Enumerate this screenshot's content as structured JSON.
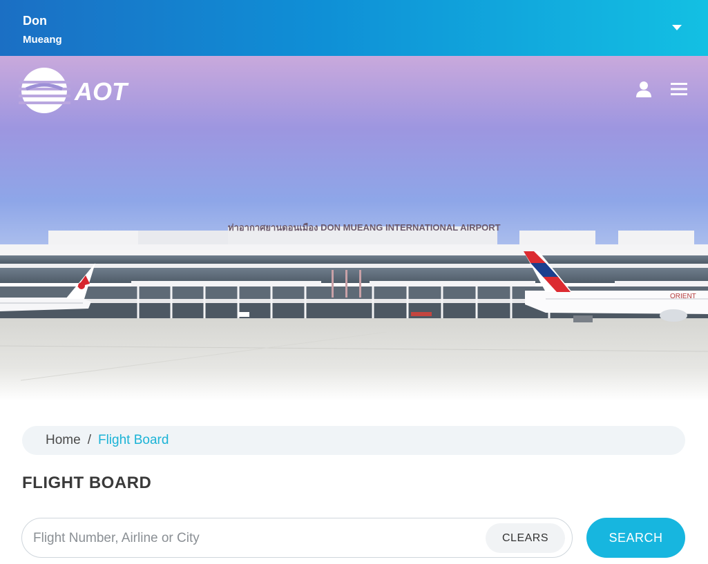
{
  "airport_selector": {
    "name_line1": "Don",
    "name_line2": "Mueang"
  },
  "brand": {
    "logo_text": "AOT"
  },
  "hero": {
    "sign_text": "DON MUEANG INTERNATIONAL AIRPORT",
    "aircraft_livery_text": "ORIENT"
  },
  "header_icons": {
    "account": "user-icon",
    "menu": "hamburger-menu-icon"
  },
  "breadcrumb": {
    "home": "Home",
    "separator": "/",
    "current": "Flight Board"
  },
  "page": {
    "title": "FLIGHT BOARD"
  },
  "search": {
    "placeholder": "Flight Number, Airline or City",
    "value": "",
    "clear_label": "CLEARS",
    "search_label": "SEARCH"
  },
  "colors": {
    "accent": "#17b6df",
    "top_bar_start": "#1b6fc4",
    "top_bar_end": "#13c0e3"
  }
}
